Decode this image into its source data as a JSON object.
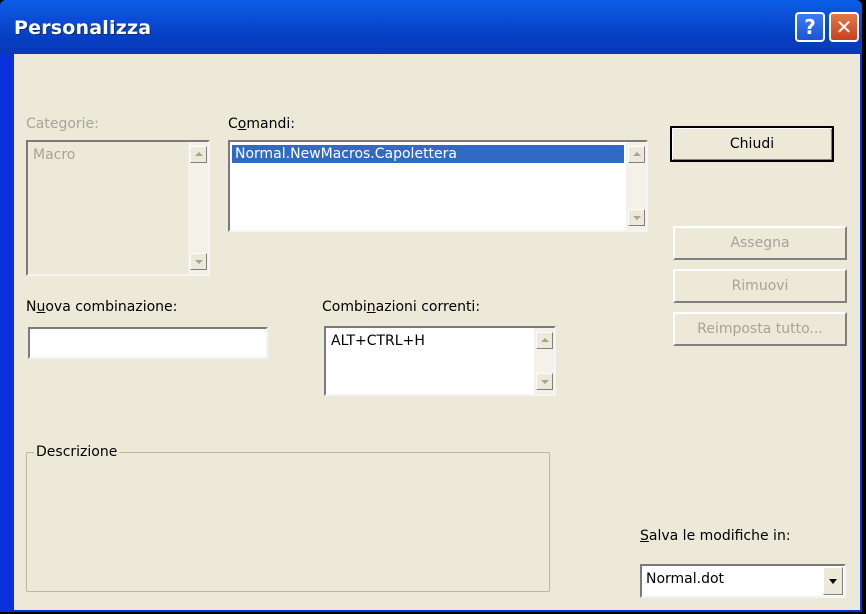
{
  "window": {
    "title": "Personalizza",
    "help_glyph": "?",
    "close_glyph": "✕"
  },
  "categories": {
    "label": "Categorie:",
    "items": [
      "Macro"
    ]
  },
  "commands": {
    "label_pre": "C",
    "label_u": "o",
    "label_post": "mandi:",
    "items": [
      "Normal.NewMacros.Capolettera"
    ]
  },
  "new_shortcut": {
    "label_pre": "N",
    "label_u": "u",
    "label_post": "ova combinazione:",
    "value": ""
  },
  "current_shortcuts": {
    "label_pre": "Combi",
    "label_u": "n",
    "label_post": "azioni correnti:",
    "items": [
      "ALT+CTRL+H"
    ]
  },
  "description": {
    "label": "Descrizione"
  },
  "buttons": {
    "close": "Chiudi",
    "assign": "Assegna",
    "remove": "Rimuovi",
    "reset_all": "Reimposta tutto..."
  },
  "save_in": {
    "label_u": "S",
    "label_post": "alva le modifiche in:",
    "value": "Normal.dot"
  }
}
